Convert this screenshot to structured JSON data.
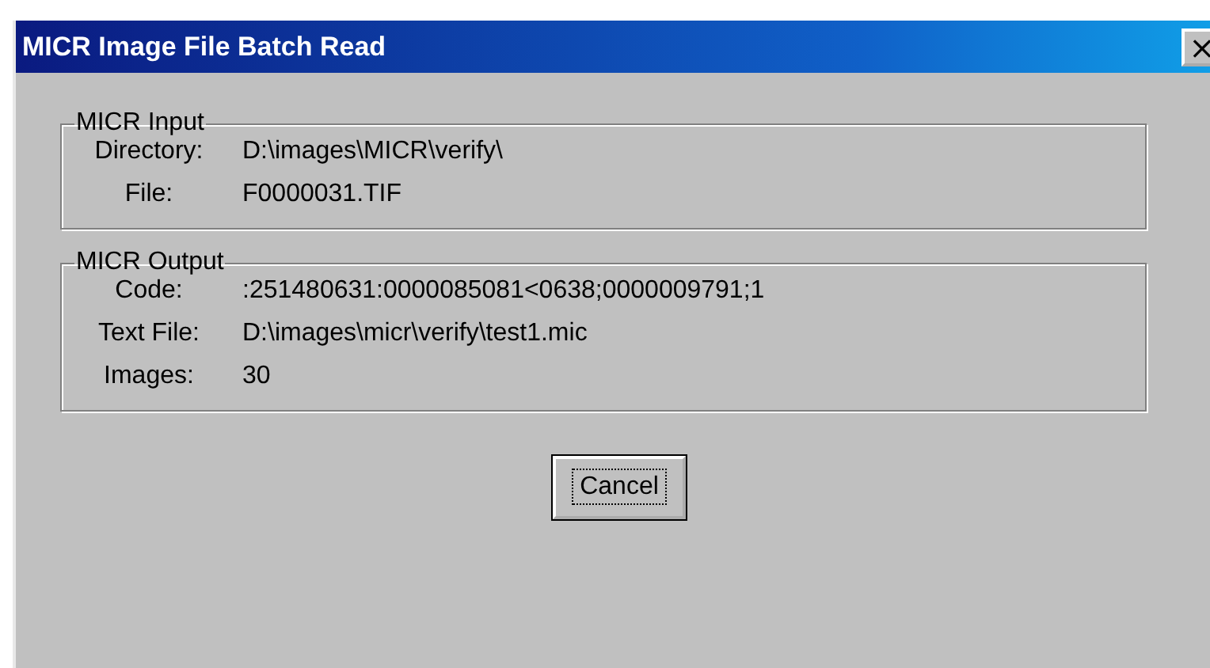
{
  "window": {
    "title": "MICR Image File Batch Read",
    "close": "×"
  },
  "groups": [
    {
      "title": "MICR Input",
      "rows": [
        {
          "label": "Directory:",
          "value": "D:\\images\\MICR\\verify\\"
        },
        {
          "label": "File:",
          "value": "F0000031.TIF"
        }
      ]
    },
    {
      "title": "MICR Output",
      "rows": [
        {
          "label": "Code:",
          "value": ":251480631:0000085081<0638;0000009791;1"
        },
        {
          "label": "Text File:",
          "value": "D:\\images\\micr\\verify\\test1.mic"
        },
        {
          "label": "Images:",
          "value": "30"
        }
      ]
    }
  ],
  "button": {
    "label": "Cancel",
    "focused": true
  }
}
